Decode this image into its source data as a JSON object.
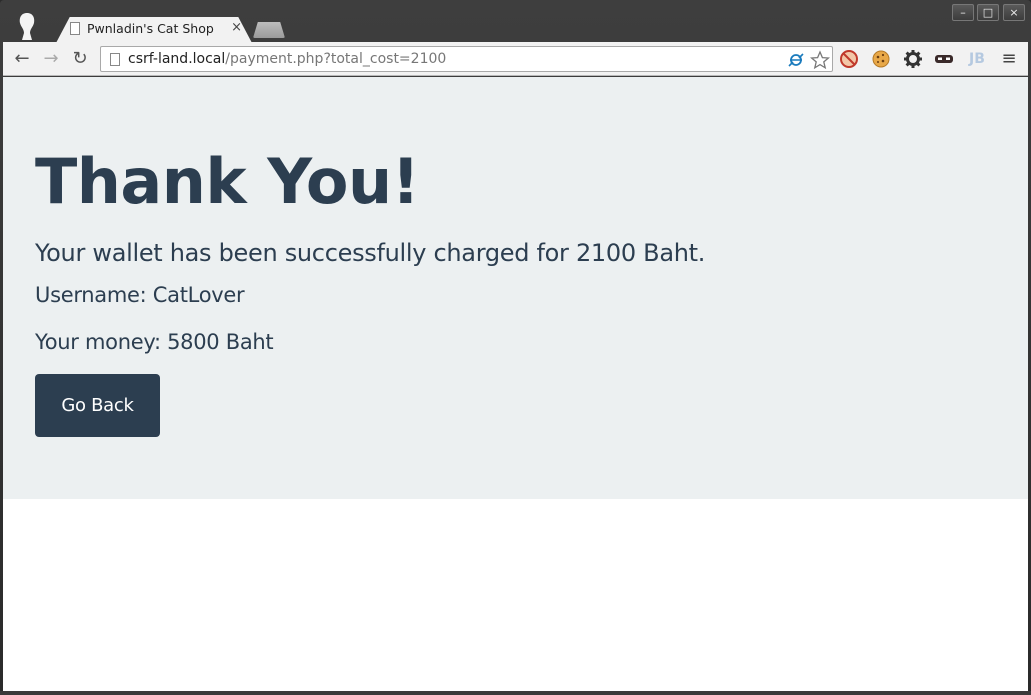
{
  "browser": {
    "tab": {
      "title": "Pwnladin's Cat Shop",
      "close_glyph": "×"
    },
    "window_controls": {
      "minimize": "–",
      "maximize": "□",
      "close": "×"
    },
    "nav": {
      "back_icon": "←",
      "forward_icon": "→",
      "reload_icon": "↻"
    },
    "address": {
      "host": "csrf-land.local",
      "path": "/payment.php?total_cost=2100"
    },
    "extensions": [
      "translate-icon",
      "star-icon",
      "blocked-icon",
      "cookie-icon",
      "gear-icon",
      "mask-icon",
      "jb-icon",
      "menu-icon"
    ],
    "extension_labels": {
      "jb": "JB"
    }
  },
  "page": {
    "headline": "Thank You!",
    "charged_message": "Your wallet has been successfully charged for 2100 Baht.",
    "username_line": "Username: CatLover",
    "money_line": "Your money: 5800 Baht",
    "go_back_label": "Go Back"
  },
  "colors": {
    "jumbotron_bg": "#ecf0f1",
    "text_primary": "#2c3e50",
    "button_bg": "#2c3e50"
  }
}
